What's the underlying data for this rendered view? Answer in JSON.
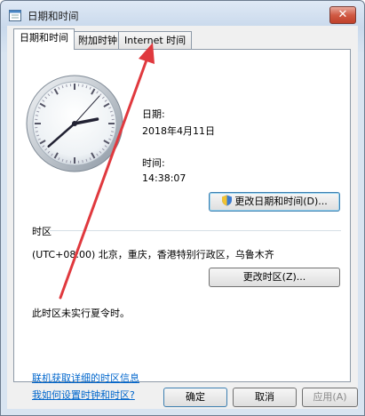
{
  "window": {
    "title": "日期和时间",
    "close_glyph": "✕"
  },
  "tabs": [
    {
      "label": "日期和时间"
    },
    {
      "label": "附加时钟"
    },
    {
      "label": "Internet 时间"
    }
  ],
  "date_section": {
    "label": "日期:",
    "value": "2018年4月11日"
  },
  "time_section": {
    "label": "时间:",
    "value": "14:38:07"
  },
  "clock": {
    "hour": 14,
    "minute": 38,
    "second": 7
  },
  "change_datetime_button": "更改日期和时间(D)...",
  "timezone": {
    "heading": "时区",
    "value": "(UTC+08:00) 北京，重庆，香港特别行政区，乌鲁木齐",
    "change_button": "更改时区(Z)...",
    "dst_note": "此时区未实行夏令时。"
  },
  "links": {
    "tz_info": "联机获取详细的时区信息",
    "how_to": "我如何设置时钟和时区?"
  },
  "buttons": {
    "ok": "确定",
    "cancel": "取消",
    "apply": "应用(A)"
  },
  "colors": {
    "link": "#0066cc",
    "arrow": "#e0393e",
    "close": "#c0402a"
  }
}
